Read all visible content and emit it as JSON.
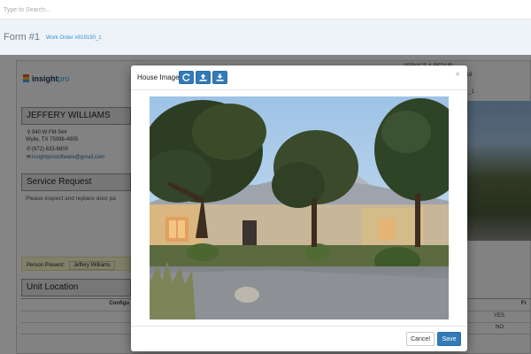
{
  "search": {
    "placeholder": "Type to Search..."
  },
  "header": {
    "form_title": "Form #1",
    "work_order": "Work Order #819190_1"
  },
  "company": {
    "logo_text": "insight",
    "logo_accent": "pro"
  },
  "header_right": {
    "line1": "SERVICE & REPAIR",
    "line2": "2018",
    "line3": "_1"
  },
  "customer": {
    "name": "JEFFERY WILLIAMS",
    "address1": "940 W FM 544",
    "address2": "Wylie, TX 75098-4905",
    "phone": "(972) 633-6800",
    "email": "insightprosoftware@gmail.com"
  },
  "service_request": {
    "heading": "Service Request",
    "text": "Please inspect and replace door pa"
  },
  "person_present": {
    "label": "Person Present:",
    "value": "Jeffery Williams"
  },
  "unit_location": {
    "heading": "Unit Location",
    "col_config": "Configu",
    "col_right": "Fr",
    "row1_value": "YES",
    "row2_value": "NO"
  },
  "modal": {
    "title": "House Image",
    "close": "×",
    "cancel_label": "Cancel",
    "save_label": "Save"
  },
  "colors": {
    "primary": "#337ab7",
    "link": "#3a8fd6",
    "highlight": "#f6f3c6"
  },
  "icons": {
    "refresh": "refresh-icon",
    "upload": "upload-icon",
    "download": "download-icon"
  }
}
